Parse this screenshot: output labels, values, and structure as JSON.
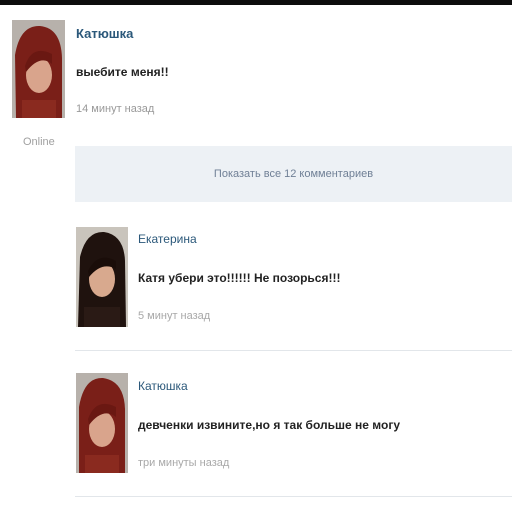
{
  "post": {
    "author": "Катюшка",
    "text": "выебите меня!!",
    "time": "14 минут назад",
    "status": "Online"
  },
  "show_comments_label": "Показать все 12 комментариев",
  "comments": [
    {
      "author": "Екатерина",
      "text": "Катя убери это!!!!!! Не позорься!!!",
      "time": "5 минут назад"
    },
    {
      "author": "Катюшка",
      "text": "девченки извините,но я так больше не могу",
      "time": "три минуты назад"
    }
  ]
}
